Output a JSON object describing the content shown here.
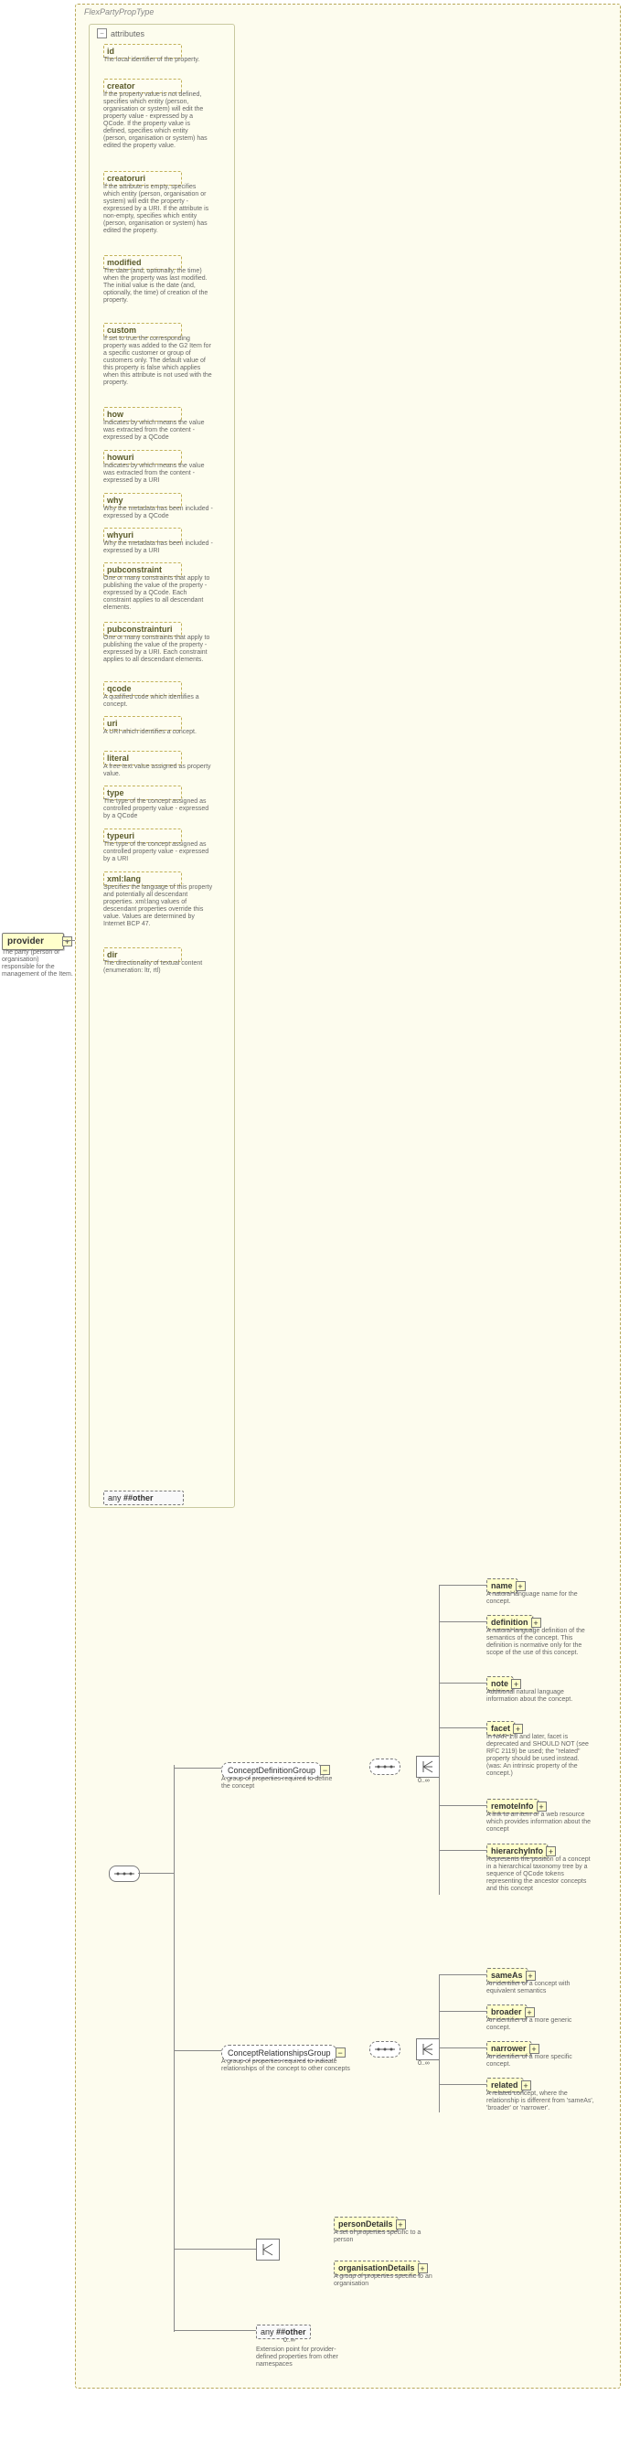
{
  "typeLabel": "FlexPartyPropType",
  "attributesLabel": "attributes",
  "occ0inf": "0..∞",
  "provider": {
    "name": "provider",
    "desc": "The party (person or organisation) responsible for the management of the Item."
  },
  "anyAttr": {
    "label": "any ",
    "ns": "##other"
  },
  "anyElem": {
    "label": "any ",
    "ns": "##other",
    "desc": "Extension point for provider-defined properties from other namespaces"
  },
  "attrs": [
    {
      "name": "id",
      "desc": "The local identifier of the property."
    },
    {
      "name": "creator",
      "desc": "If the property value is not defined, specifies which entity (person, organisation or system) will edit the property value - expressed by a QCode. If the property value is defined, specifies which entity (person, organisation or system) has edited the property value."
    },
    {
      "name": "creatoruri",
      "desc": "If the attribute is empty, specifies which entity (person, organisation or system) will edit the property - expressed by a URI. If the attribute is non-empty, specifies which entity (person, organisation or system) has edited the property."
    },
    {
      "name": "modified",
      "desc": "The date (and, optionally, the time) when the property was last modified. The initial value is the date (and, optionally, the time) of creation of the property."
    },
    {
      "name": "custom",
      "desc": "If set to true the corresponding property was added to the G2 Item for a specific customer or group of customers only. The default value of this property is false which applies when this attribute is not used with the property."
    },
    {
      "name": "how",
      "desc": "Indicates by which means the value was extracted from the content - expressed by a QCode"
    },
    {
      "name": "howuri",
      "desc": "Indicates by which means the value was extracted from the content - expressed by a URI"
    },
    {
      "name": "why",
      "desc": "Why the metadata has been included - expressed by a QCode"
    },
    {
      "name": "whyuri",
      "desc": "Why the metadata has been included - expressed by a URI"
    },
    {
      "name": "pubconstraint",
      "desc": "One or many constraints that apply to publishing the value of the property - expressed by a QCode. Each constraint applies to all descendant elements."
    },
    {
      "name": "pubconstrainturi",
      "desc": "One or many constraints that apply to publishing the value of the property - expressed by a URI. Each constraint applies to all descendant elements."
    },
    {
      "name": "qcode",
      "desc": "A qualified code which identifies a concept."
    },
    {
      "name": "uri",
      "desc": "A URI which identifies a concept."
    },
    {
      "name": "literal",
      "desc": "A free-text value assigned as property value."
    },
    {
      "name": "type",
      "desc": "The type of the concept assigned as controlled property value - expressed by a QCode"
    },
    {
      "name": "typeuri",
      "desc": "The type of the concept assigned as controlled property value - expressed by a URI"
    },
    {
      "name": "xml:lang",
      "desc": "Specifies the language of this property and potentially all descendant properties. xml:lang values of descendant properties override this value. Values are determined by Internet BCP 47."
    },
    {
      "name": "dir",
      "desc": "The directionality of textual content (enumeration: ltr, rtl)"
    }
  ],
  "groups": {
    "def": {
      "name": "ConceptDefinitionGroup",
      "desc": "A group of properties required to define the concept",
      "children": [
        {
          "name": "name",
          "desc": "A natural language name for the concept."
        },
        {
          "name": "definition",
          "desc": "A natural language definition of the semantics of the concept. This definition is normative only for the scope of the use of this concept."
        },
        {
          "name": "note",
          "desc": "Additional natural language information about the concept."
        },
        {
          "name": "facet",
          "desc": "In NAR 1.8 and later, facet is deprecated and SHOULD NOT (see RFC 2119) be used; the \"related\" property should be used instead. (was: An intrinsic property of the concept.)"
        },
        {
          "name": "remoteInfo",
          "desc": "A link to an item or a web resource which provides information about the concept"
        },
        {
          "name": "hierarchyInfo",
          "desc": "Represents the position of a concept in a hierarchical taxonomy tree by a sequence of QCode tokens representing the ancestor concepts and this concept"
        }
      ]
    },
    "rel": {
      "name": "ConceptRelationshipsGroup",
      "desc": "A group of properties required to indicate relationships of the concept to other concepts",
      "children": [
        {
          "name": "sameAs",
          "desc": "An identifier of a concept with equivalent semantics"
        },
        {
          "name": "broader",
          "desc": "An identifier of a more generic concept."
        },
        {
          "name": "narrower",
          "desc": "An identifier of a more specific concept."
        },
        {
          "name": "related",
          "desc": "A related concept, where the relationship is different from 'sameAs', 'broader' or 'narrower'."
        }
      ]
    }
  },
  "party": {
    "person": {
      "name": "personDetails",
      "desc": "A set of properties specific to a person"
    },
    "org": {
      "name": "organisationDetails",
      "desc": "A group of properties specific to an organisation"
    }
  }
}
